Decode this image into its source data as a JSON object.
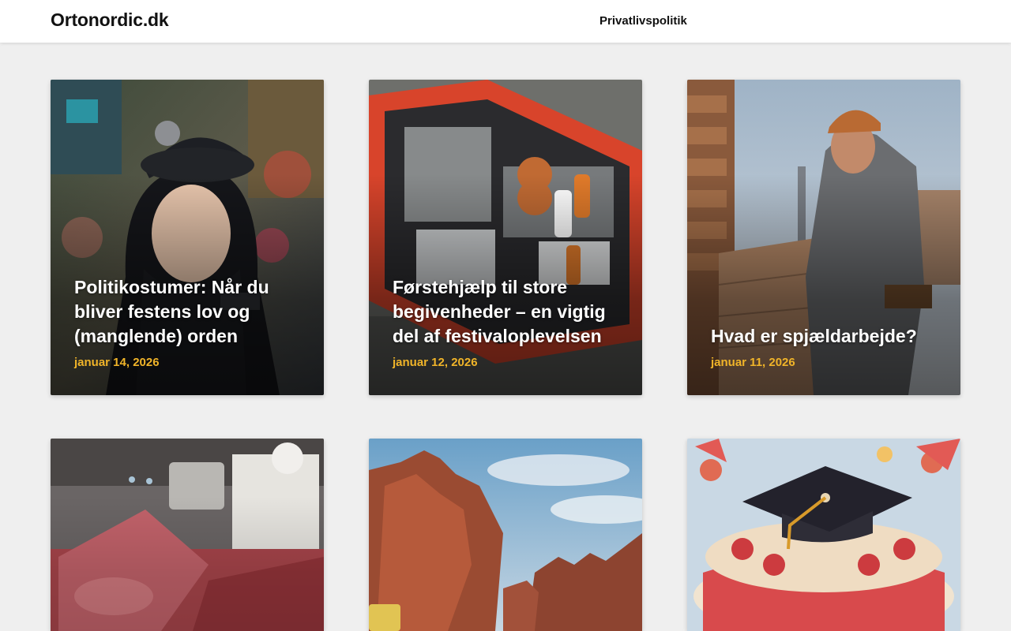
{
  "header": {
    "site_title": "Ortonordic.dk",
    "nav": [
      {
        "label": "Privatlivspolitik"
      }
    ]
  },
  "posts": [
    {
      "title": "Politikostumer: Når du bliver festens lov og (manglende) orden",
      "date": "januar 14, 2026",
      "image_icon": "police-costume-photo"
    },
    {
      "title": "Førstehjælp til store begivenheder – en vigtig del af festivaloplevelsen",
      "date": "januar 12, 2026",
      "image_icon": "first-aid-kit-photo"
    },
    {
      "title": "Hvad er spjældarbejde?",
      "date": "januar 11, 2026",
      "image_icon": "bricklayer-photo"
    },
    {
      "title": "",
      "date": "",
      "image_icon": "meat-counter-photo"
    },
    {
      "title": "",
      "date": "",
      "image_icon": "red-rock-canyon-photo"
    },
    {
      "title": "",
      "date": "",
      "image_icon": "graduation-cake-photo"
    }
  ],
  "colors": {
    "accent_date": "#f0b429",
    "page_bg": "#efefef",
    "header_bg": "#ffffff"
  }
}
